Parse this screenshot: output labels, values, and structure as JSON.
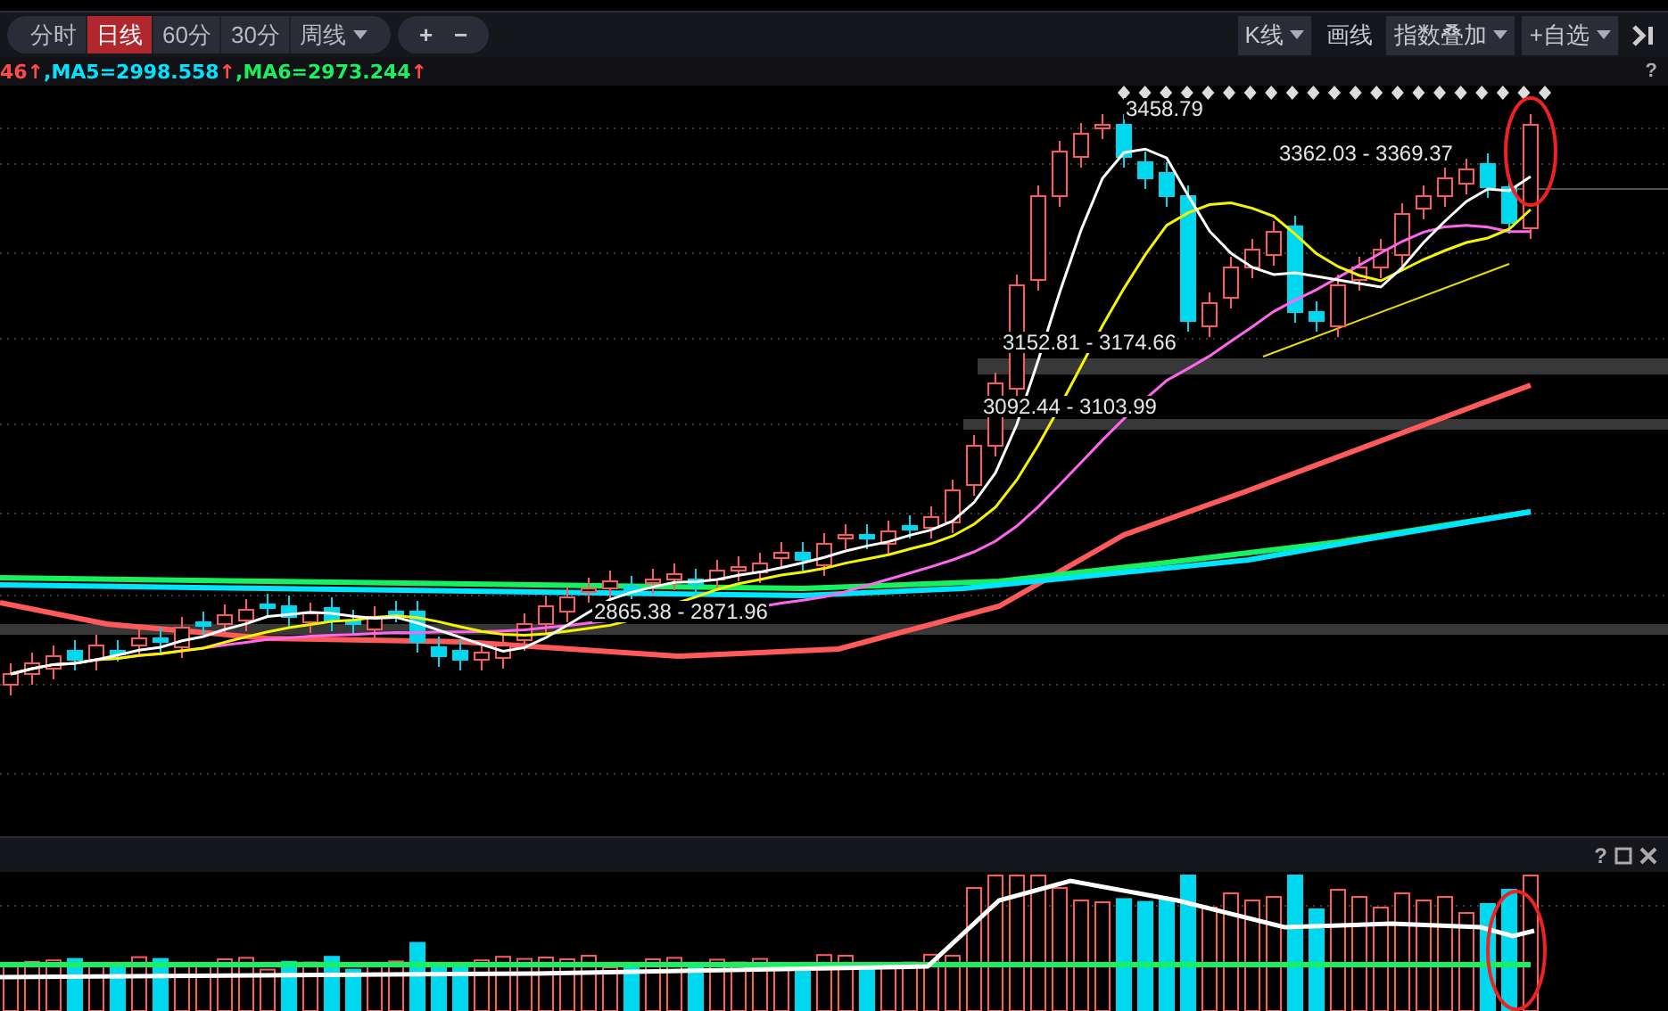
{
  "toolbar": {
    "period_tabs": [
      {
        "label": "分时",
        "selected": false
      },
      {
        "label": "日线",
        "selected": true
      },
      {
        "label": "60分",
        "selected": false
      },
      {
        "label": "30分",
        "selected": false
      }
    ],
    "period_menu": {
      "label": "周线"
    },
    "zoom_buttons": [
      "+",
      "−"
    ],
    "right_buttons": [
      {
        "label": "K线",
        "kind": "dropdown"
      },
      {
        "label": "画线",
        "kind": "plain"
      },
      {
        "label": "指数叠加",
        "kind": "dropdown"
      },
      {
        "label": "+自选",
        "kind": "dropdown"
      }
    ]
  },
  "legend": [
    {
      "text": "46↑",
      "color": "#ff4a4a"
    },
    {
      "text": ",MA5=2998.558",
      "color": "#00e5ff"
    },
    {
      "text": "↑",
      "color": "#ff4a4a"
    },
    {
      "text": ",MA6=2973.244",
      "color": "#19f060"
    },
    {
      "text": "↑",
      "color": "#ff4a4a"
    }
  ],
  "main_chart": {
    "help": "?",
    "price_labels": [
      "3458.79",
      "3362.03 - 3369.37",
      "3152.81 - 3174.66",
      "3092.44 - 3103.99",
      "2865.38 - 2871.96"
    ]
  },
  "volume_panel": {
    "help": "?"
  }
}
